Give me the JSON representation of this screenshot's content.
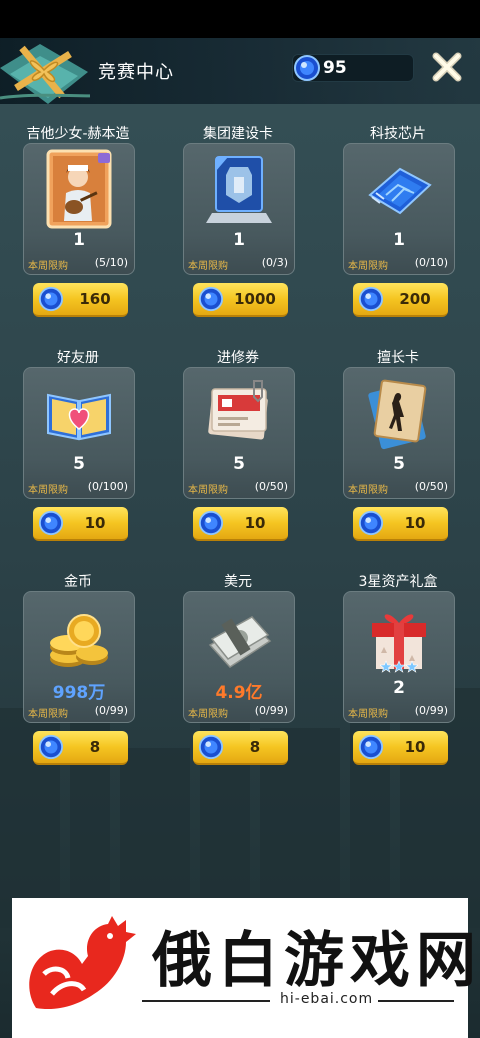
{
  "header": {
    "title": "竞赛中心",
    "currency": "95"
  },
  "colors": {
    "button_gold": "#f5c521",
    "limit_label": "#e8b848",
    "qty_blue": "#5fa3ff",
    "qty_orange": "#ff7a2a"
  },
  "items": [
    {
      "name": "吉他少女-赫本造",
      "qty": "1",
      "limit_label": "本周限购",
      "limit": "(5/10)",
      "price": "160",
      "icon": "guitar-girl-card-icon"
    },
    {
      "name": "集团建设卡",
      "qty": "1",
      "limit_label": "本周限购",
      "limit": "(0/3)",
      "price": "1000",
      "icon": "building-card-icon"
    },
    {
      "name": "科技芯片",
      "qty": "1",
      "limit_label": "本周限购",
      "limit": "(0/10)",
      "price": "200",
      "icon": "chip-icon"
    },
    {
      "name": "好友册",
      "qty": "5",
      "limit_label": "本周限购",
      "limit": "(0/100)",
      "price": "10",
      "icon": "friend-book-icon"
    },
    {
      "name": "进修券",
      "qty": "5",
      "limit_label": "本周限购",
      "limit": "(0/50)",
      "price": "10",
      "icon": "training-voucher-icon"
    },
    {
      "name": "擅长卡",
      "qty": "5",
      "limit_label": "本周限购",
      "limit": "(0/50)",
      "price": "10",
      "icon": "skill-card-icon"
    },
    {
      "name": "金币",
      "qty": "998万",
      "limit_label": "本周限购",
      "limit": "(0/99)",
      "price": "8",
      "icon": "gold-coins-icon"
    },
    {
      "name": "美元",
      "qty": "4.9亿",
      "limit_label": "本周限购",
      "limit": "(0/99)",
      "price": "8",
      "icon": "dollar-stack-icon"
    },
    {
      "name": "3星资产礼盒",
      "qty": "2",
      "limit_label": "本周限购",
      "limit": "(0/99)",
      "price": "10",
      "icon": "gift-box-icon"
    }
  ],
  "watermark": {
    "text": "俄白游戏网",
    "url": "hi-ebai.com"
  }
}
